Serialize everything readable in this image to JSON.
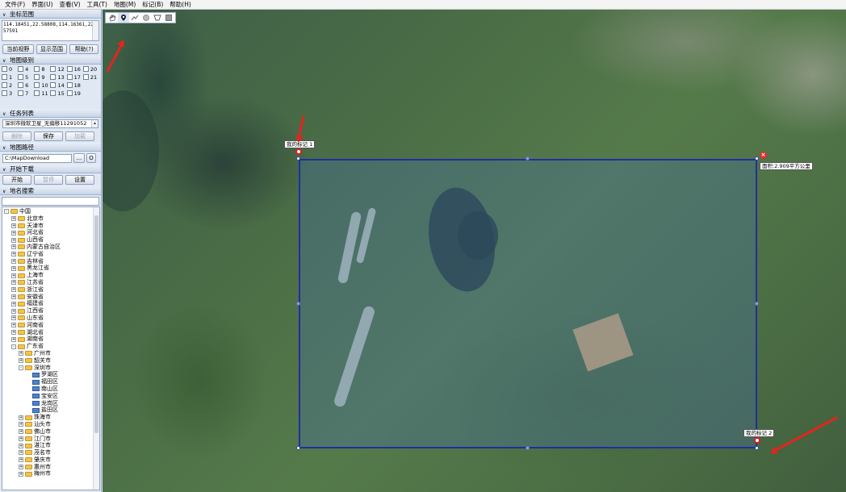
{
  "menu": [
    "文件(F)",
    "界面(U)",
    "查看(V)",
    "工具(T)",
    "地图(M)",
    "标记(B)",
    "帮助(H)"
  ],
  "sections": {
    "coords": "坐标范围",
    "levels": "地图级别",
    "tasks": "任务列表",
    "path": "地图路径",
    "download": "开始下载",
    "search": "地名搜索"
  },
  "coords_value": "114.18451,22.58808,114.16361,22.57591",
  "coord_buttons": {
    "current_view": "当前视野",
    "show_range": "显示范围",
    "help": "帮助(?)"
  },
  "levels": [
    "0",
    "4",
    "8",
    "12",
    "16",
    "20",
    "1",
    "5",
    "9",
    "13",
    "17",
    "21",
    "2",
    "6",
    "10",
    "14",
    "18",
    "",
    "3",
    "7",
    "11",
    "15",
    "19",
    ""
  ],
  "task": {
    "selected": "深圳市微软卫星_无偏移11291052",
    "delete": "删除",
    "save": "保存",
    "load": "加载"
  },
  "path": {
    "value": "C:\\MapDownload",
    "browse": "...",
    "open": "O"
  },
  "download": {
    "start": "开始",
    "pause": "暂停",
    "settings": "设置"
  },
  "search": {
    "placeholder": ""
  },
  "tree": [
    {
      "label": "中国",
      "depth": 0,
      "exp": "-",
      "icon": "folder"
    },
    {
      "label": "北京市",
      "depth": 1,
      "exp": "+",
      "icon": "folder"
    },
    {
      "label": "天津市",
      "depth": 1,
      "exp": "+",
      "icon": "folder"
    },
    {
      "label": "河北省",
      "depth": 1,
      "exp": "+",
      "icon": "folder"
    },
    {
      "label": "山西省",
      "depth": 1,
      "exp": "+",
      "icon": "folder"
    },
    {
      "label": "内蒙古自治区",
      "depth": 1,
      "exp": "+",
      "icon": "folder"
    },
    {
      "label": "辽宁省",
      "depth": 1,
      "exp": "+",
      "icon": "folder"
    },
    {
      "label": "吉林省",
      "depth": 1,
      "exp": "+",
      "icon": "folder"
    },
    {
      "label": "黑龙江省",
      "depth": 1,
      "exp": "+",
      "icon": "folder"
    },
    {
      "label": "上海市",
      "depth": 1,
      "exp": "+",
      "icon": "folder"
    },
    {
      "label": "江苏省",
      "depth": 1,
      "exp": "+",
      "icon": "folder"
    },
    {
      "label": "浙江省",
      "depth": 1,
      "exp": "+",
      "icon": "folder"
    },
    {
      "label": "安徽省",
      "depth": 1,
      "exp": "+",
      "icon": "folder"
    },
    {
      "label": "福建省",
      "depth": 1,
      "exp": "+",
      "icon": "folder"
    },
    {
      "label": "江西省",
      "depth": 1,
      "exp": "+",
      "icon": "folder"
    },
    {
      "label": "山东省",
      "depth": 1,
      "exp": "+",
      "icon": "folder"
    },
    {
      "label": "河南省",
      "depth": 1,
      "exp": "+",
      "icon": "folder"
    },
    {
      "label": "湖北省",
      "depth": 1,
      "exp": "+",
      "icon": "folder"
    },
    {
      "label": "湖南省",
      "depth": 1,
      "exp": "+",
      "icon": "folder"
    },
    {
      "label": "广东省",
      "depth": 1,
      "exp": "-",
      "icon": "folder"
    },
    {
      "label": "广州市",
      "depth": 2,
      "exp": "+",
      "icon": "folder"
    },
    {
      "label": "韶关市",
      "depth": 2,
      "exp": "+",
      "icon": "folder"
    },
    {
      "label": "深圳市",
      "depth": 2,
      "exp": "-",
      "icon": "folder"
    },
    {
      "label": "罗湖区",
      "depth": 3,
      "exp": "",
      "icon": "map"
    },
    {
      "label": "福田区",
      "depth": 3,
      "exp": "",
      "icon": "map"
    },
    {
      "label": "南山区",
      "depth": 3,
      "exp": "",
      "icon": "map"
    },
    {
      "label": "宝安区",
      "depth": 3,
      "exp": "",
      "icon": "map"
    },
    {
      "label": "龙岗区",
      "depth": 3,
      "exp": "",
      "icon": "map"
    },
    {
      "label": "盐田区",
      "depth": 3,
      "exp": "",
      "icon": "map"
    },
    {
      "label": "珠海市",
      "depth": 2,
      "exp": "+",
      "icon": "folder"
    },
    {
      "label": "汕头市",
      "depth": 2,
      "exp": "+",
      "icon": "folder"
    },
    {
      "label": "佛山市",
      "depth": 2,
      "exp": "+",
      "icon": "folder"
    },
    {
      "label": "江门市",
      "depth": 2,
      "exp": "+",
      "icon": "folder"
    },
    {
      "label": "湛江市",
      "depth": 2,
      "exp": "+",
      "icon": "folder"
    },
    {
      "label": "茂名市",
      "depth": 2,
      "exp": "+",
      "icon": "folder"
    },
    {
      "label": "肇庆市",
      "depth": 2,
      "exp": "+",
      "icon": "folder"
    },
    {
      "label": "惠州市",
      "depth": 2,
      "exp": "+",
      "icon": "folder"
    },
    {
      "label": "梅州市",
      "depth": 2,
      "exp": "+",
      "icon": "folder"
    }
  ],
  "map": {
    "tools": [
      "hand-icon",
      "marker-pin-icon",
      "polyline-icon",
      "circle-icon",
      "polygon-icon",
      "rectangle-icon"
    ],
    "marker1": "我的标记 1",
    "marker2": "我的标记 2",
    "area": "面积:2.909平方公里",
    "close": "×"
  },
  "colors": {
    "selection_border": "#1f2fa0",
    "arrow": "#e3251e",
    "marker": "#d72020"
  }
}
